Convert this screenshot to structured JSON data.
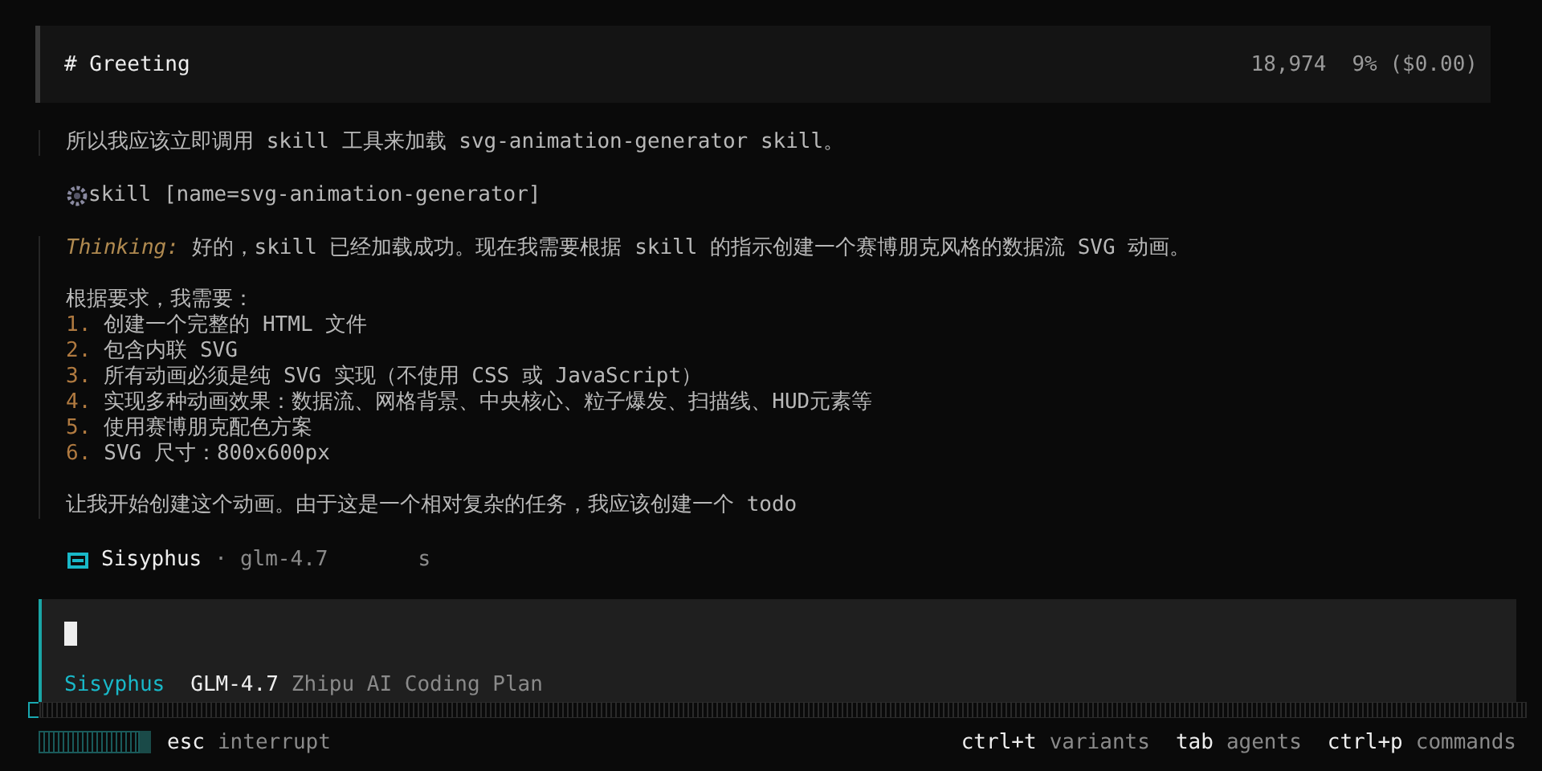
{
  "header": {
    "title": "# Greeting",
    "tokens": "18,974",
    "usage": "9% ($0.00)"
  },
  "transcript": [
    {
      "kind": "text",
      "text": "所以我应该立即调用 skill 工具来加载 svg-animation-generator skill。"
    },
    {
      "kind": "tool",
      "text": "skill [name=svg-animation-generator]"
    },
    {
      "kind": "thinking",
      "label": "Thinking:",
      "text": "好的，skill 已经加载成功。现在我需要根据 skill 的指示创建一个赛博朋克风格的数据流 SVG 动画。",
      "intro": "根据要求，我需要：",
      "items": [
        {
          "number": "1.",
          "text": "创建一个完整的 HTML 文件"
        },
        {
          "number": "2.",
          "text": "包含内联 SVG"
        },
        {
          "number": "3.",
          "text": "所有动画必须是纯 SVG 实现（不使用 CSS 或 JavaScript）"
        },
        {
          "number": "4.",
          "text": "实现多种动画效果：数据流、网格背景、中央核心、粒子爆发、扫描线、HUD元素等"
        },
        {
          "number": "5.",
          "text": "使用赛博朋克配色方案"
        },
        {
          "number": "6.",
          "text": "SVG 尺寸：800x600px"
        }
      ],
      "closing": "让我开始创建这个动画。由于这是一个相对复杂的任务，我应该创建一个 todo"
    }
  ],
  "status": {
    "agent": "Sisyphus",
    "separator": "·",
    "model": "glm-4.7",
    "spinner": "s"
  },
  "input": {
    "agent": "Sisyphus",
    "model": "GLM-4.7",
    "provider": "Zhipu AI Coding Plan"
  },
  "footer": {
    "key": "esc",
    "action": "interrupt",
    "shortcuts": [
      {
        "key": "ctrl+t",
        "action": "variants"
      },
      {
        "key": "tab",
        "action": "agents"
      },
      {
        "key": "ctrl+p",
        "action": "commands"
      }
    ]
  }
}
